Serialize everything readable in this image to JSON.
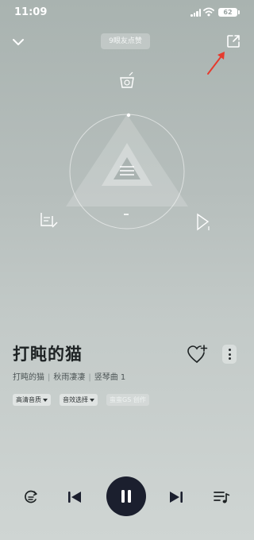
{
  "status_bar": {
    "time": "11:09",
    "battery": "62"
  },
  "header": {
    "likes_pill": "9眼友点赞"
  },
  "song": {
    "title": "打盹的猫",
    "subtitle": [
      "打盹的猫",
      "秋雨凄凄",
      "竖琴曲 1"
    ]
  },
  "tags": [
    {
      "label": "高清音质",
      "has_caret": true
    },
    {
      "label": "音效选择",
      "has_caret": true
    },
    {
      "label": "蛮蛮GS 创作",
      "has_caret": false
    }
  ],
  "icons": {
    "status": [
      "signal-icon",
      "wifi-icon",
      "battery-icon"
    ],
    "header": [
      "chevron-down-icon",
      "share-icon",
      "red-arrow-annotation"
    ],
    "visual": [
      "top-node-icon",
      "left-node-icon",
      "right-node-icon"
    ],
    "song": [
      "heart-plus-icon",
      "more-vertical-icon"
    ],
    "controls": [
      "loop-mode-icon",
      "previous-icon",
      "pause-icon",
      "next-icon",
      "playlist-icon"
    ]
  },
  "colors": {
    "play_button": "#1b1f2e",
    "annotation_arrow": "#e63b2e",
    "background_top": "#a9b3b0",
    "background_bottom": "#cfd5d3"
  },
  "player": {
    "is_playing": true
  }
}
